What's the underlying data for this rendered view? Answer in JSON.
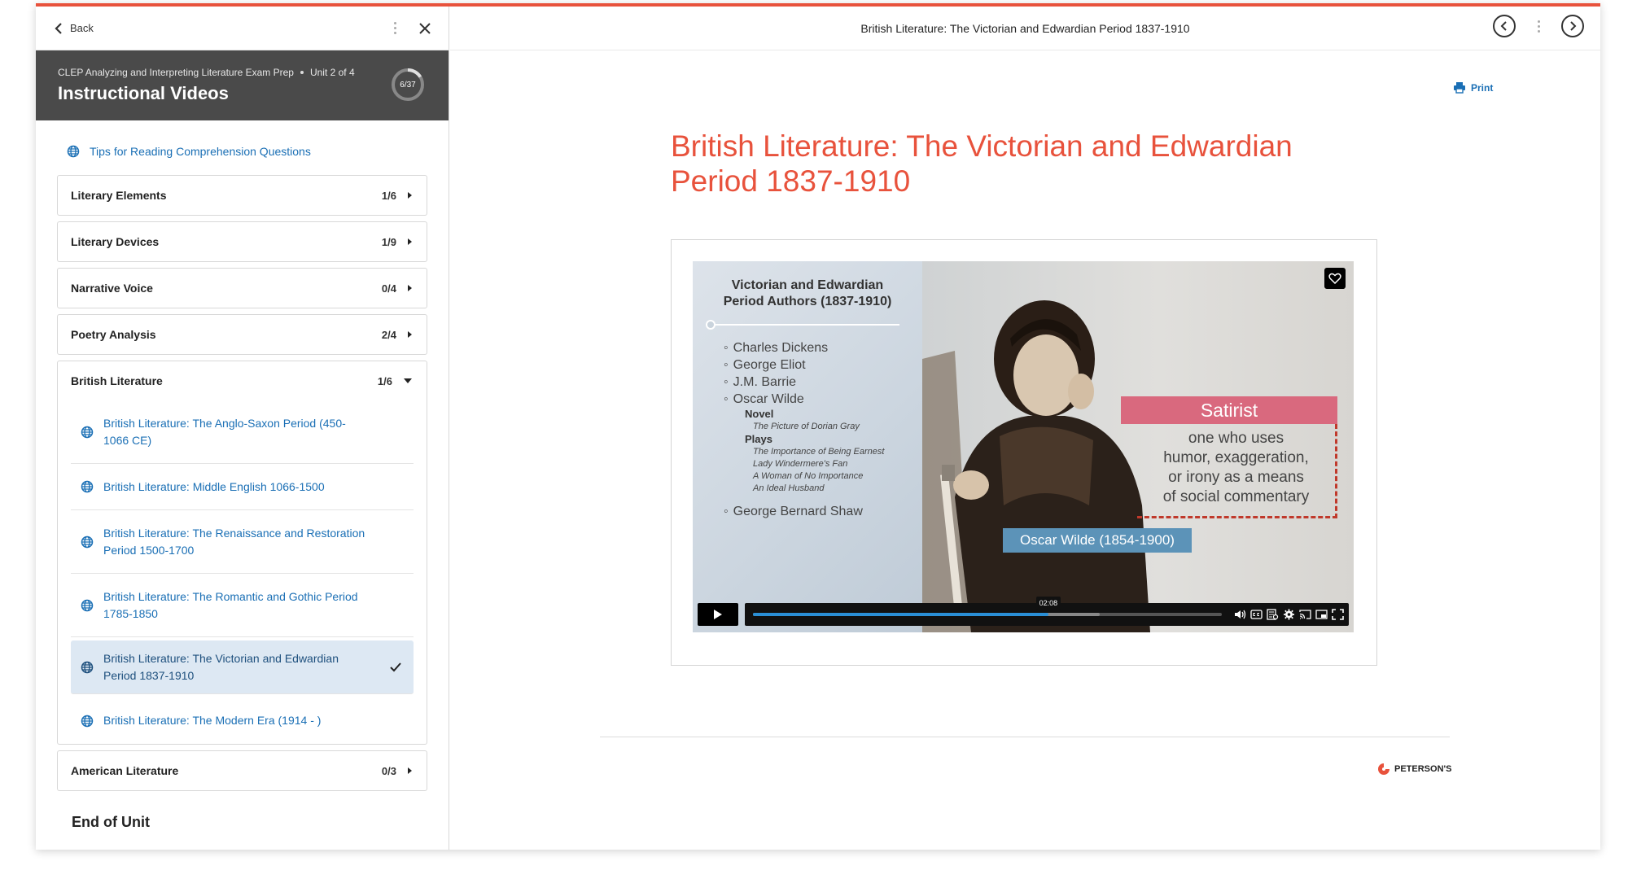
{
  "sidebar": {
    "back_label": "Back",
    "course": "CLEP Analyzing and Interpreting Literature Exam Prep",
    "unit": "Unit 2 of 4",
    "section_title": "Instructional Videos",
    "progress": {
      "label": "6/37",
      "completed": 6,
      "total": 37
    },
    "tip_link": "Tips for Reading Comprehension Questions",
    "accordions": [
      {
        "label": "Literary Elements",
        "count": "1/6",
        "expanded": false
      },
      {
        "label": "Literary Devices",
        "count": "1/9",
        "expanded": false
      },
      {
        "label": "Narrative Voice",
        "count": "0/4",
        "expanded": false
      },
      {
        "label": "Poetry Analysis",
        "count": "2/4",
        "expanded": false
      },
      {
        "label": "British Literature",
        "count": "1/6",
        "expanded": true
      },
      {
        "label": "American Literature",
        "count": "0/3",
        "expanded": false
      }
    ],
    "british_lessons": [
      "British Literature: The Anglo-Saxon Period (450-1066 CE)",
      "British Literature: Middle English 1066-1500",
      "British Literature: The Renaissance and Restoration Period 1500-1700",
      "British Literature: The Romantic and Gothic Period 1785-1850",
      "British Literature: The Victorian and Edwardian Period 1837-1910",
      "British Literature: The Modern Era (1914 - )"
    ],
    "end_label": "End of Unit"
  },
  "header": {
    "title": "British Literature: The Victorian and Edwardian Period 1837-1910"
  },
  "main": {
    "print_label": "Print",
    "lesson_title": "British Literature: The Victorian and Edwardian Period 1837-1910",
    "brand": "PETERSON'S"
  },
  "video": {
    "slide_heading_1": "Victorian and Edwardian",
    "slide_heading_2": "Period Authors (1837-1910)",
    "authors": [
      "Charles Dickens",
      "George Eliot",
      "J.M. Barrie",
      "Oscar Wilde"
    ],
    "novel_label": "Novel",
    "novel": "The Picture of Dorian Gray",
    "plays_label": "Plays",
    "plays": [
      "The Importance of Being Earnest",
      "Lady Windermere's Fan",
      "A Woman of No Importance",
      "An Ideal Husband"
    ],
    "last_author": "George Bernard Shaw",
    "term": "Satirist",
    "definition": [
      "one who uses",
      "humor, exaggeration,",
      "or irony as a means",
      "of social commentary"
    ],
    "caption": "Oscar Wilde (1854-1900)",
    "time": "02:08",
    "progress": 0.63,
    "buffered": 0.74
  },
  "colors": {
    "accent": "#e8523c",
    "link": "#1a6fb5",
    "banner": "#4a4a4a",
    "active_bg": "#dde8f3"
  }
}
